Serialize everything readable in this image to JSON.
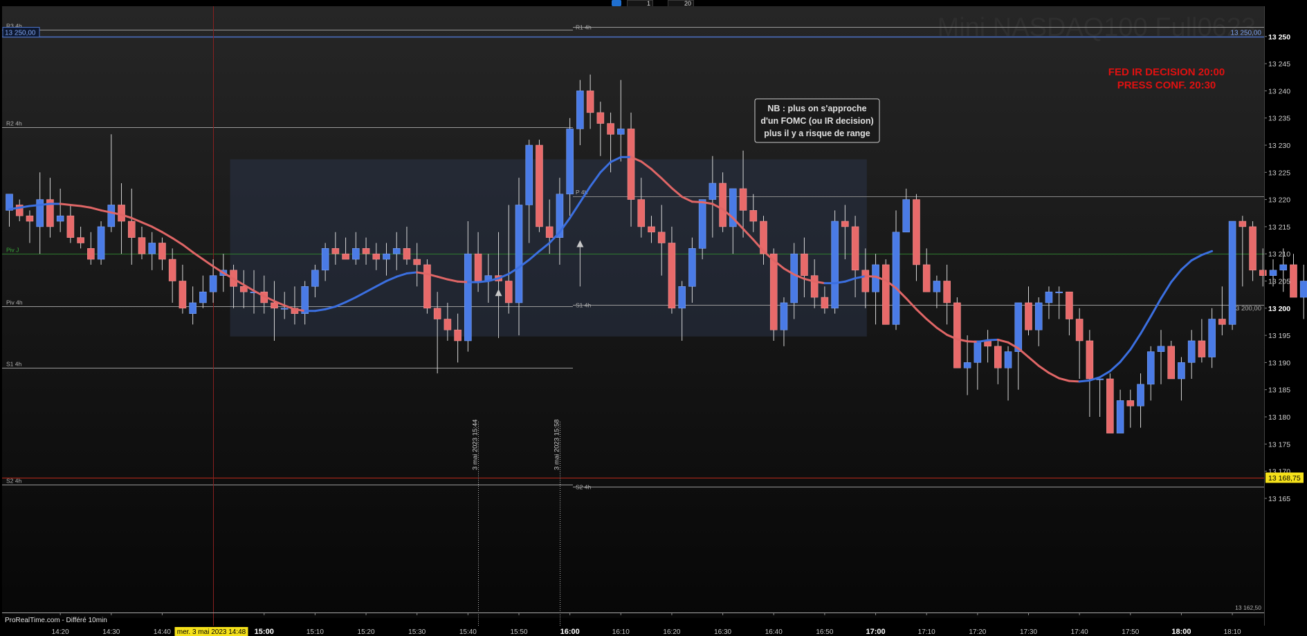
{
  "instrument": "Mini NASDAQ100 Full0623",
  "toolbar": {
    "field1": "1",
    "field2": "20"
  },
  "source_label": "ProRealTime.com - Différé 10min",
  "cursor_date_label": "mer. 3 mai 2023 14:48",
  "price_left_label": "13 250,00",
  "price_right_label": "13 250,00",
  "current_price_label": "13 168,75",
  "bottom_right_price": "13 162,50",
  "right_price_label_13200": "13 200,00",
  "fed_note": [
    "FED IR DECISION 20:00",
    "PRESS CONF. 20:30"
  ],
  "nb_note": [
    "NB : plus on s'approche",
    "d'un FOMC (ou IR decision)",
    "plus il y a risque de range"
  ],
  "colors": {
    "up": "#4a7be6",
    "down": "#e86a6a",
    "ma_up": "#3b6fe0",
    "ma_down": "#e06666",
    "fed_red": "#e01010",
    "price_yellow": "#f5e11a"
  },
  "chart_data": {
    "type": "candlestick",
    "title": "Mini NASDAQ100 Full0623",
    "ylim": [
      13160,
      13252
    ],
    "y_ticks": [
      13165,
      13170,
      13175,
      13180,
      13185,
      13190,
      13195,
      13200,
      13205,
      13210,
      13215,
      13220,
      13225,
      13230,
      13235,
      13240,
      13245,
      13250
    ],
    "y_tick_labels": [
      "13 165",
      "13 170",
      "13 175",
      "13 180",
      "13 185",
      "13 190",
      "13 195",
      "13 200",
      "13 205",
      "13 210",
      "13 215",
      "13 220",
      "13 225",
      "13 230",
      "13 235",
      "13 240",
      "13 245",
      "13 250"
    ],
    "x_ticks": [
      {
        "label": "14:20",
        "bar": 5,
        "bold": false
      },
      {
        "label": "14:30",
        "bar": 10,
        "bold": false
      },
      {
        "label": "14:40",
        "bar": 15,
        "bold": false
      },
      {
        "label": "15:00",
        "bar": 25,
        "bold": true
      },
      {
        "label": "15:10",
        "bar": 30,
        "bold": false
      },
      {
        "label": "15:20",
        "bar": 35,
        "bold": false
      },
      {
        "label": "15:30",
        "bar": 40,
        "bold": false
      },
      {
        "label": "15:40",
        "bar": 45,
        "bold": false
      },
      {
        "label": "15:50",
        "bar": 50,
        "bold": false
      },
      {
        "label": "16:00",
        "bar": 55,
        "bold": true
      },
      {
        "label": "16:10",
        "bar": 60,
        "bold": false
      },
      {
        "label": "16:20",
        "bar": 65,
        "bold": false
      },
      {
        "label": "16:30",
        "bar": 70,
        "bold": false
      },
      {
        "label": "16:40",
        "bar": 75,
        "bold": false
      },
      {
        "label": "16:50",
        "bar": 80,
        "bold": false
      },
      {
        "label": "17:00",
        "bar": 85,
        "bold": true
      },
      {
        "label": "17:10",
        "bar": 90,
        "bold": false
      },
      {
        "label": "17:20",
        "bar": 95,
        "bold": false
      },
      {
        "label": "17:30",
        "bar": 100,
        "bold": false
      },
      {
        "label": "17:40",
        "bar": 105,
        "bold": false
      },
      {
        "label": "17:50",
        "bar": 110,
        "bold": false
      },
      {
        "label": "18:00",
        "bar": 115,
        "bold": true
      },
      {
        "label": "18:10",
        "bar": 120,
        "bold": false
      }
    ],
    "ohlc": [
      [
        13218,
        13220,
        13215,
        13221
      ],
      [
        13219,
        13220,
        13216,
        13217
      ],
      [
        13217,
        13218,
        13212,
        13216
      ],
      [
        13215,
        13225,
        13210,
        13220
      ],
      [
        13220,
        13224,
        13213,
        13215
      ],
      [
        13216,
        13222,
        13214,
        13217
      ],
      [
        13217,
        13219,
        13212,
        13213
      ],
      [
        13213,
        13215,
        13211,
        13212
      ],
      [
        13211,
        13214,
        13208,
        13209
      ],
      [
        13209,
        13216,
        13208,
        13215
      ],
      [
        13215,
        13232,
        13214,
        13219
      ],
      [
        13219,
        13223,
        13210,
        13216
      ],
      [
        13216,
        13222,
        13208,
        13213
      ],
      [
        13213,
        13215,
        13209,
        13210
      ],
      [
        13210,
        13214,
        13207,
        13212
      ],
      [
        13212,
        13213,
        13207,
        13209
      ],
      [
        13209,
        13211,
        13201,
        13205
      ],
      [
        13205,
        13208,
        13199,
        13200
      ],
      [
        13199,
        13204,
        13197,
        13201
      ],
      [
        13201,
        13206,
        13200,
        13203
      ],
      [
        13203,
        13209,
        13201,
        13206
      ],
      [
        13206,
        13210,
        13203,
        13207
      ],
      [
        13207,
        13208,
        13200,
        13204
      ],
      [
        13204,
        13207,
        13200,
        13203
      ],
      [
        13203,
        13207,
        13199,
        13203
      ],
      [
        13203,
        13206,
        13199,
        13201
      ],
      [
        13201,
        13205,
        13194,
        13200
      ],
      [
        13200,
        13203,
        13198,
        13200
      ],
      [
        13200,
        13204,
        13197,
        13199
      ],
      [
        13199,
        13205,
        13197,
        13204
      ],
      [
        13204,
        13208,
        13202,
        13207
      ],
      [
        13207,
        13212,
        13205,
        13211
      ],
      [
        13211,
        13214,
        13208,
        13210
      ],
      [
        13210,
        13213,
        13209,
        13209
      ],
      [
        13209,
        13214,
        13208,
        13211
      ],
      [
        13211,
        13213,
        13208,
        13210
      ],
      [
        13210,
        13212,
        13207,
        13209
      ],
      [
        13209,
        13212,
        13206,
        13210
      ],
      [
        13210,
        13214,
        13207,
        13211
      ],
      [
        13211,
        13215,
        13208,
        13209
      ],
      [
        13209,
        13212,
        13204,
        13208
      ],
      [
        13208,
        13209,
        13199,
        13200
      ],
      [
        13200,
        13203,
        13188,
        13198
      ],
      [
        13198,
        13201,
        13194,
        13196
      ],
      [
        13196,
        13199,
        13190,
        13194
      ],
      [
        13194,
        13216,
        13192,
        13210
      ],
      [
        13210,
        13214,
        13203,
        13205
      ],
      [
        13205,
        13210,
        13201,
        13206
      ],
      [
        13206,
        13214,
        13200,
        13205
      ],
      [
        13205,
        13219,
        13199,
        13201
      ],
      [
        13201,
        13224,
        13195,
        13219
      ],
      [
        13219,
        13231,
        13212,
        13230
      ],
      [
        13230,
        13231,
        13214,
        13215
      ],
      [
        13215,
        13220,
        13210,
        13213
      ],
      [
        13213,
        13224,
        13208,
        13221
      ],
      [
        13221,
        13235,
        13217,
        13233
      ],
      [
        13233,
        13242,
        13230,
        13240
      ],
      [
        13240,
        13243,
        13233,
        13236
      ],
      [
        13236,
        13238,
        13228,
        13234
      ],
      [
        13234,
        13236,
        13225,
        13232
      ],
      [
        13232,
        13242,
        13227,
        13233
      ],
      [
        13233,
        13236,
        13215,
        13220
      ],
      [
        13220,
        13224,
        13213,
        13215
      ],
      [
        13215,
        13217,
        13212,
        13214
      ],
      [
        13214,
        13219,
        13206,
        13212
      ],
      [
        13212,
        13215,
        13199,
        13200
      ],
      [
        13200,
        13205,
        13194,
        13204
      ],
      [
        13204,
        13213,
        13201,
        13211
      ],
      [
        13211,
        13218,
        13209,
        13220
      ],
      [
        13220,
        13228,
        13213,
        13223
      ],
      [
        13223,
        13225,
        13214,
        13215
      ],
      [
        13215,
        13219,
        13210,
        13222
      ],
      [
        13222,
        13229,
        13213,
        13218
      ],
      [
        13218,
        13221,
        13214,
        13216
      ],
      [
        13216,
        13217,
        13208,
        13210
      ],
      [
        13210,
        13211,
        13194,
        13196
      ],
      [
        13196,
        13202,
        13193,
        13201
      ],
      [
        13201,
        13212,
        13198,
        13210
      ],
      [
        13210,
        13213,
        13202,
        13206
      ],
      [
        13206,
        13209,
        13200,
        13202
      ],
      [
        13202,
        13204,
        13199,
        13200
      ],
      [
        13200,
        13218,
        13199,
        13216
      ],
      [
        13216,
        13219,
        13209,
        13215
      ],
      [
        13215,
        13217,
        13202,
        13207
      ],
      [
        13207,
        13211,
        13200,
        13203
      ],
      [
        13203,
        13210,
        13197,
        13208
      ],
      [
        13208,
        13209,
        13197,
        13197
      ],
      [
        13197,
        13218,
        13196,
        13214
      ],
      [
        13214,
        13222,
        13214,
        13220
      ],
      [
        13220,
        13221,
        13205,
        13208
      ],
      [
        13208,
        13211,
        13203,
        13203
      ],
      [
        13203,
        13206,
        13200,
        13205
      ],
      [
        13205,
        13208,
        13197,
        13201
      ],
      [
        13201,
        13202,
        13189,
        13189
      ],
      [
        13189,
        13195,
        13184,
        13190
      ],
      [
        13190,
        13194,
        13185,
        13194
      ],
      [
        13194,
        13196,
        13190,
        13193
      ],
      [
        13193,
        13194,
        13186,
        13189
      ],
      [
        13189,
        13193,
        13183,
        13192
      ],
      [
        13192,
        13201,
        13185,
        13201
      ],
      [
        13201,
        13204,
        13195,
        13196
      ],
      [
        13196,
        13202,
        13193,
        13201
      ],
      [
        13201,
        13204,
        13198,
        13203
      ],
      [
        13203,
        13204,
        13198,
        13203
      ],
      [
        13203,
        13203,
        13195,
        13198
      ],
      [
        13198,
        13200,
        13187,
        13194
      ],
      [
        13194,
        13196,
        13180,
        13187
      ],
      [
        13187,
        13187,
        13180,
        13187
      ],
      [
        13187,
        13188,
        13179,
        13177
      ],
      [
        13177,
        13185,
        13178,
        13183
      ],
      [
        13183,
        13185,
        13178,
        13182
      ],
      [
        13182,
        13188,
        13178,
        13186
      ],
      [
        13186,
        13193,
        13183,
        13192
      ],
      [
        13192,
        13196,
        13186,
        13193
      ],
      [
        13193,
        13194,
        13188,
        13187
      ],
      [
        13187,
        13191,
        13183,
        13190
      ],
      [
        13190,
        13196,
        13187,
        13194
      ],
      [
        13194,
        13198,
        13190,
        13191
      ],
      [
        13191,
        13200,
        13189,
        13198
      ],
      [
        13198,
        13204,
        13195,
        13197
      ],
      [
        13197,
        13214,
        13196,
        13216
      ],
      [
        13216,
        13217,
        13204,
        13215
      ],
      [
        13215,
        13216,
        13205,
        13207
      ],
      [
        13207,
        13211,
        13204,
        13206
      ],
      [
        13206,
        13209,
        13204,
        13207
      ],
      [
        13207,
        13211,
        13203,
        13208
      ],
      [
        13208,
        13210,
        13203,
        13202
      ],
      [
        13202,
        13208,
        13198,
        13205
      ]
    ],
    "moving_average": [
      13218.2,
      13218.5,
      13218.8,
      13219.0,
      13219.2,
      13219.2,
      13219.0,
      13218.8,
      13218.5,
      13218.0,
      13217.6,
      13217.2,
      13216.6,
      13215.8,
      13215.0,
      13214.0,
      13212.9,
      13211.7,
      13210.3,
      13209.0,
      13207.7,
      13206.5,
      13205.4,
      13204.3,
      13203.2,
      13202.2,
      13201.3,
      13200.5,
      13199.8,
      13199.5,
      13199.5,
      13199.8,
      13200.3,
      13201.1,
      13202.0,
      13203.0,
      13204.0,
      13205.0,
      13205.8,
      13206.4,
      13206.6,
      13206.3,
      13205.8,
      13205.3,
      13204.9,
      13204.8,
      13204.8,
      13205.0,
      13205.5,
      13206.3,
      13207.5,
      13208.9,
      13210.5,
      13212.0,
      13214.0,
      13216.6,
      13219.5,
      13222.4,
      13225.0,
      13226.9,
      13227.8,
      13227.8,
      13227.0,
      13225.6,
      13223.9,
      13222.1,
      13220.5,
      13219.6,
      13219.5,
      13219.2,
      13218.2,
      13216.6,
      13214.6,
      13212.6,
      13210.5,
      13208.8,
      13207.3,
      13206.2,
      13205.4,
      13204.9,
      13204.6,
      13204.6,
      13204.9,
      13205.5,
      13205.9,
      13205.8,
      13205.1,
      13203.7,
      13201.8,
      13199.8,
      13198.0,
      13196.4,
      13195.1,
      13194.3,
      13193.9,
      13193.8,
      13194.1,
      13194.2,
      13193.7,
      13192.6,
      13191.0,
      13189.4,
      13188.1,
      13187.1,
      13186.6,
      13186.5,
      13186.7,
      13187.3,
      13188.4,
      13190.1,
      13192.4,
      13195.3,
      13198.5,
      13201.8,
      13204.8,
      13207.1,
      13208.8,
      13209.8,
      13210.5
    ],
    "horizontal_lines": [
      {
        "label": "R3 4h",
        "value": 13251.2
      },
      {
        "label": "R2 4h",
        "value": 13233.3
      },
      {
        "label": "Piv J",
        "value": 13210.0
      },
      {
        "label": "Piv 4h",
        "value": 13200.4
      },
      {
        "label": "S1 4h",
        "value": 13189.0
      },
      {
        "label": "S2 4h",
        "value": 13167.5
      }
    ],
    "horizontal_lines_right": [
      {
        "label": "R1 4h",
        "value": 13251.8
      },
      {
        "label": "S1 4h",
        "value": 13200.6
      },
      {
        "label": "S2 4h",
        "value": 13167.1
      }
    ],
    "pivot_mid_label": "P 4h",
    "range_box": {
      "from_bar": 22,
      "to_bar": 84,
      "high": 13227.4,
      "low": 13194.8
    },
    "upper_band_value": 13250.0,
    "current_price": 13168.75,
    "marker_lines": [
      {
        "label": "3 mai 2023 15:44",
        "bar": 46
      },
      {
        "label": "3 mai 2023 15:58",
        "bar": 54
      }
    ],
    "arrows": [
      {
        "bar": 48,
        "from": 13194.5,
        "to": 13203.5
      },
      {
        "bar": 56,
        "from": 13204.0,
        "to": 13212.5
      }
    ],
    "cursor_bar": 20
  }
}
